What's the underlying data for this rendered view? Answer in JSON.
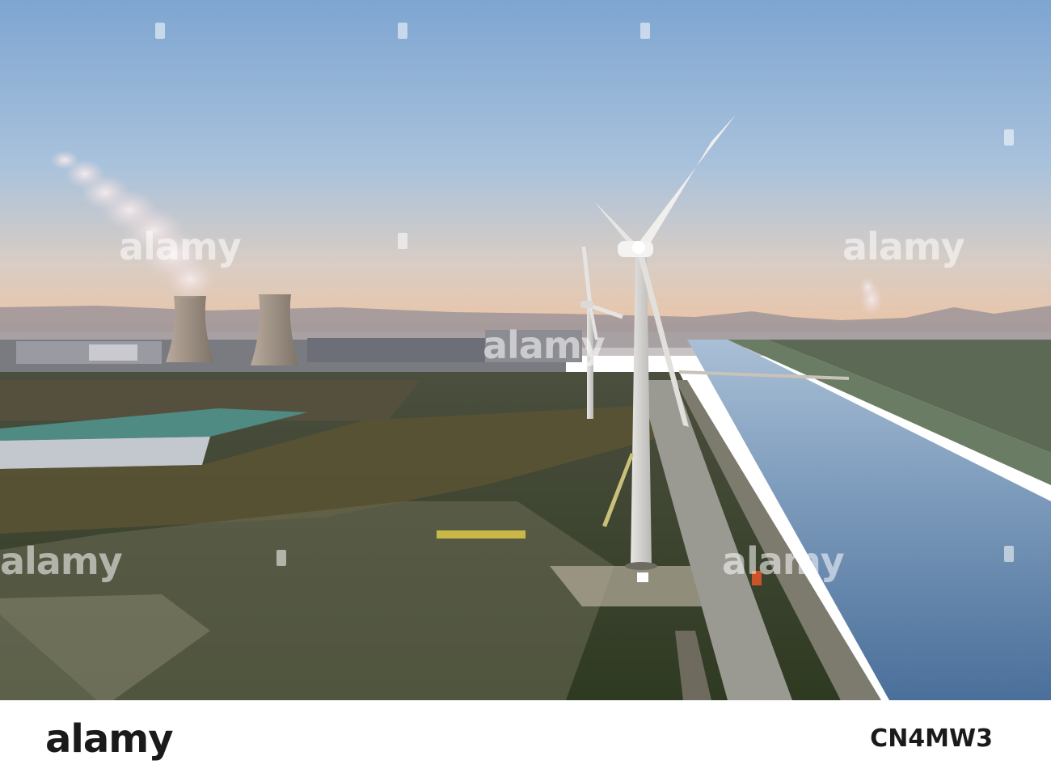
{
  "watermark": {
    "text": "alamy"
  },
  "footer": {
    "brand": "alamy",
    "image_id": "CN4MW3"
  },
  "colors": {
    "sky_top": "#7fa6cf",
    "sky_horizon": "#e9c6a4",
    "water": "#5b7fa6",
    "ground": "#3d4a2e",
    "turbine": "#f2f2f2"
  }
}
